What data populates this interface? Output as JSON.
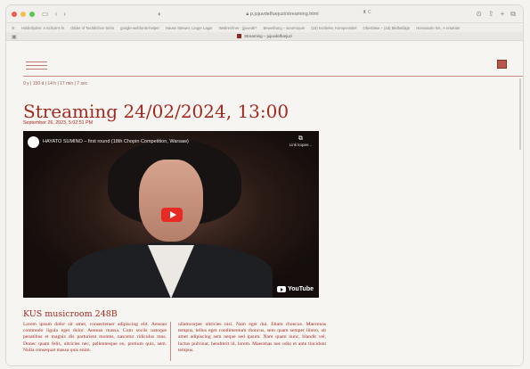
{
  "browser": {
    "url": "p.jujuvdelfuejuzi/streaming.html",
    "reader_label": "♜ C",
    "tab_title": "Streaming – jujuvdelfuejuzi",
    "bookmarks": [
      "Holderlyden: a Schule's fn",
      "Gilder of Tachtlichen Sehn",
      "google-webfonts-helper",
      "Hause Steiwer, Lieger Lager",
      "Webrechner - jjjuvedti?",
      "Bewerbung – sieurroqum",
      "(18) Ivorbeke, Kompenstitel",
      "Obesbleie – (18) Bildbeldige",
      "Honnaturin Str., A nnwinter"
    ],
    "colors": {
      "close": "#ee5b52",
      "minimize": "#f3be4e",
      "zoom": "#5ec454"
    }
  },
  "page": {
    "ticker": "0 y | 150 d | 14 h | 17 min | 7 sec",
    "title": "Streaming 24/02/2024, 13:00",
    "date": "September 26, 2023, 5:02:51 PM",
    "accent_color": "#a3291f"
  },
  "video": {
    "title": "HAYATO SUMINO – first round (18th Chopin Competition, Warsaw)",
    "share_label": "Link kopier...",
    "youtube_label": "YouTube"
  },
  "room": {
    "name": "KUS musicroom 248B",
    "col1": "Lorem ipsum dolor sit amet, consectetuer adipiscing elit. Aenean commodo ligula eget dolor. Aenean massa. Cum sociis natoque penatibus et magnis dis parturient montes, nascetur ridiculus mus. Donec quam felis, ultricies nec, pellentesque eu, pretium quis, sem. Nulla consequat massa quis enim.",
    "col2": "ullamcorper ultricies nisi. Nam eget dui. Etiam rhoncus. Maecenas tempus, tellus eget condimentum rhoncus, sem quam semper libero, sit amet adipiscing sem neque sed ipsum. Nam quam nunc, blandit vel, luctus pulvinar, hendrerit id, lorem. Maecenas nec odio et ante tincidunt tempus."
  }
}
